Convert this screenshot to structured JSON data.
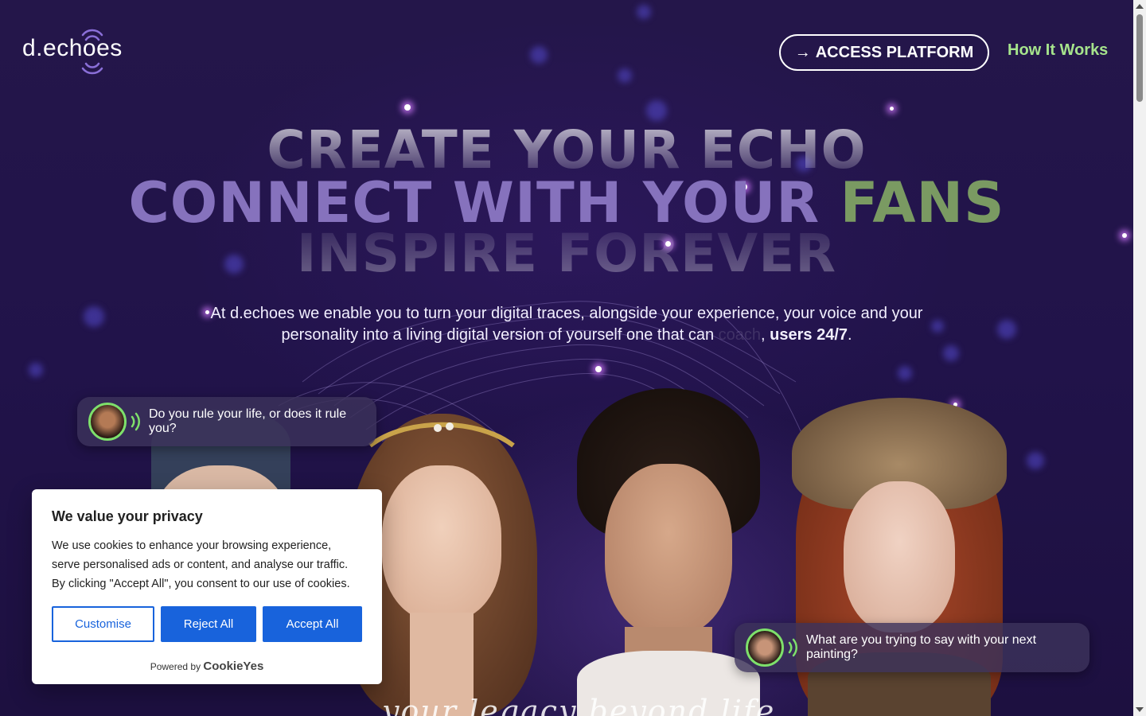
{
  "header": {
    "logo_text": "d.echoes",
    "access_button": "ACCESS PLATFORM",
    "access_arrow": "→",
    "how_link": "How It Works"
  },
  "hero": {
    "line1": "CREATE YOUR ECHO",
    "line2_main": "CONNECT WITH YOUR ",
    "line2_accent": "FANS",
    "line3": "INSPIRE FOREVER",
    "intro_part1": "At d.echoes we enable you to turn your digital traces, alongside your experience, your voice and your personality into a living digital version of yourself one that can ",
    "intro_faded": "coach",
    "intro_part2": ", ",
    "intro_strong": "users 24/7",
    "intro_end": "."
  },
  "bubbles": {
    "left": "Do you rule your life, or does it rule you?",
    "right": "What are you trying to say with your next painting?"
  },
  "cookie": {
    "title": "We value your privacy",
    "body": "We use cookies to enhance your browsing experience, serve personalised ads or content, and analyse our traffic. By clicking \"Accept All\", you consent to our use of cookies.",
    "customise": "Customise",
    "reject": "Reject All",
    "accept": "Accept All",
    "powered_by": "Powered by",
    "brand": "CookieYes"
  },
  "tagline": "your legacy beyond life",
  "colors": {
    "accent_green": "#a6e48c",
    "purple_text": "#8672bd",
    "cookie_blue": "#1863dc",
    "background": "#231546"
  }
}
